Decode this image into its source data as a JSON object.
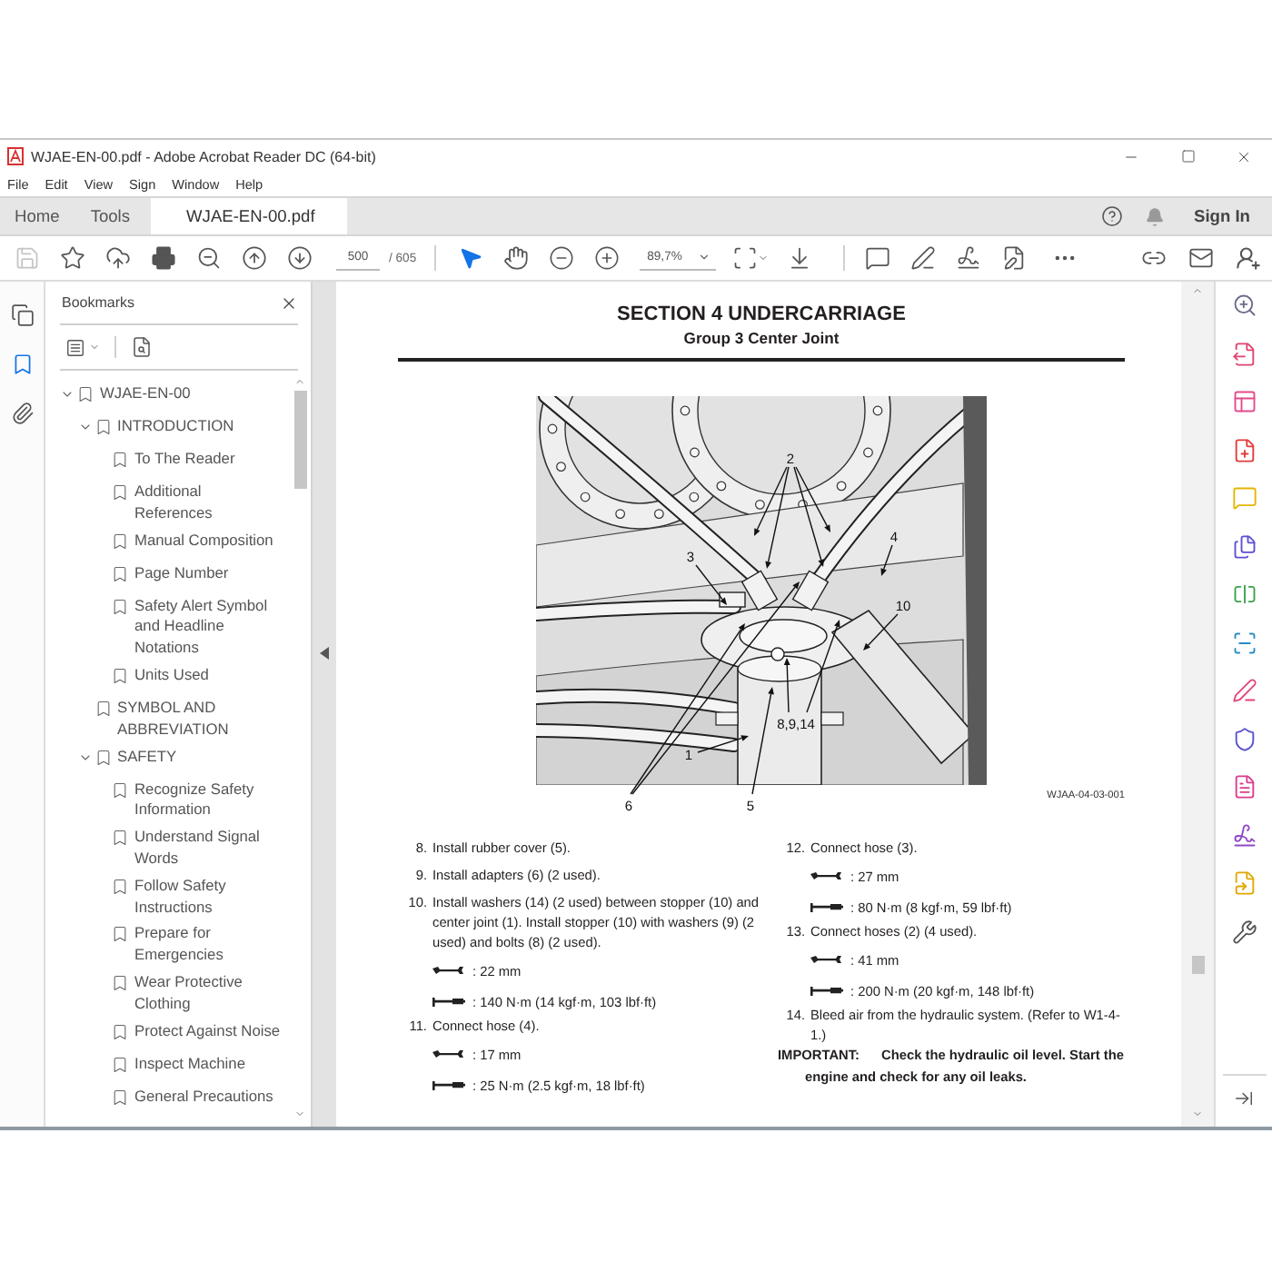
{
  "window": {
    "title": "WJAE-EN-00.pdf - Adobe Acrobat Reader DC (64-bit)"
  },
  "menu": [
    "File",
    "Edit",
    "View",
    "Sign",
    "Window",
    "Help"
  ],
  "tabs": [
    {
      "label": "Home",
      "selected": false,
      "kind": "view"
    },
    {
      "label": "Tools",
      "selected": false,
      "kind": "view"
    },
    {
      "label": "WJAE-EN-00.pdf",
      "selected": true,
      "kind": "document"
    }
  ],
  "account": {
    "sign_in": "Sign In"
  },
  "toolbar": {
    "buttons": [
      {
        "kind": "save",
        "disabled": true
      },
      {
        "kind": "star",
        "disabled": false
      },
      {
        "kind": "upload",
        "disabled": false
      },
      {
        "kind": "print",
        "disabled": false
      },
      {
        "kind": "find",
        "disabled": false
      },
      {
        "kind": "previous",
        "disabled": false
      },
      {
        "kind": "next",
        "disabled": false
      }
    ],
    "page": "500",
    "page_count": "/ 605",
    "modes": [
      {
        "kind": "select",
        "selected": true
      },
      {
        "kind": "hand",
        "selected": false
      }
    ],
    "zoom": "89,7%"
  },
  "side_rail": [
    {
      "kind": "pages",
      "selected": false
    },
    {
      "kind": "bookmarks",
      "selected": true
    },
    {
      "kind": "attachments",
      "selected": false
    }
  ],
  "bookmarks_panel": {
    "title": "Bookmarks",
    "items": [
      {
        "label": "WJAE-EN-00",
        "expanded": true,
        "children": [
          {
            "label": "INTRODUCTION",
            "expanded": true,
            "children": [
              {
                "label": "To The Reader"
              },
              {
                "label": "Additional References"
              },
              {
                "label": "Manual Composition"
              },
              {
                "label": "Page Number"
              },
              {
                "label": "Safety Alert Symbol and Headline Notations"
              },
              {
                "label": "Units Used"
              }
            ]
          },
          {
            "label": "SYMBOL AND ABBREVIATION"
          },
          {
            "label": "SAFETY",
            "expanded": true,
            "children": [
              {
                "label": "Recognize Safety Information"
              },
              {
                "label": "Understand Signal Words"
              },
              {
                "label": "Follow Safety Instructions"
              },
              {
                "label": "Prepare for Emergencies"
              },
              {
                "label": "Wear Protective Clothing"
              },
              {
                "label": "Protect Against Noise"
              },
              {
                "label": "Inspect Machine"
              },
              {
                "label": "General Precautions"
              }
            ]
          }
        ]
      }
    ]
  },
  "document": {
    "section_title": "SECTION 4 UNDERCARRIAGE",
    "group_title": "Group 3 Center Joint",
    "figure": {
      "callouts": [
        {
          "label": "2"
        },
        {
          "label": "3"
        },
        {
          "label": "4"
        },
        {
          "label": "10"
        },
        {
          "label": "8,9,14"
        },
        {
          "label": "1"
        },
        {
          "label": "6"
        },
        {
          "label": "5"
        }
      ],
      "code": "WJAA-04-03-001"
    },
    "columns": [
      [
        {
          "kind": "step",
          "number": "8.",
          "text": "Install rubber cover (5)."
        },
        {
          "kind": "step",
          "number": "9.",
          "text": "Install adapters (6) (2 used)."
        },
        {
          "kind": "step",
          "number": "10.",
          "text": "Install washers (14) (2 used) between stopper (10) and center joint (1). Install stopper (10) with washers (9) (2 used) and bolts (8) (2 used)."
        },
        {
          "kind": "wrench",
          "text": ": 22 mm"
        },
        {
          "kind": "torque",
          "text": ": 140 N·m (14 kgf·m, 103 lbf·ft)"
        },
        {
          "kind": "step",
          "number": "11.",
          "text": "Connect hose (4)."
        },
        {
          "kind": "wrench",
          "text": ": 17 mm"
        },
        {
          "kind": "torque",
          "text": ": 25 N·m (2.5 kgf·m, 18 lbf·ft)"
        }
      ],
      [
        {
          "kind": "step",
          "number": "12.",
          "text": "Connect hose (3)."
        },
        {
          "kind": "wrench",
          "text": ": 27 mm"
        },
        {
          "kind": "torque",
          "text": ": 80 N·m (8 kgf·m, 59 lbf·ft)"
        },
        {
          "kind": "step",
          "number": "13.",
          "text": "Connect hoses (2) (4 used)."
        },
        {
          "kind": "wrench",
          "text": ": 41 mm"
        },
        {
          "kind": "torque",
          "text": ": 200 N·m (20 kgf·m, 148 lbf·ft)"
        },
        {
          "kind": "step",
          "number": "14.",
          "text": "Bleed air from the hydraulic system. (Refer to W1-4-1.)"
        },
        {
          "kind": "note",
          "label": "IMPORTANT:",
          "text": "Check the hydraulic oil level. Start the engine and check for any oil leaks."
        }
      ]
    ]
  }
}
